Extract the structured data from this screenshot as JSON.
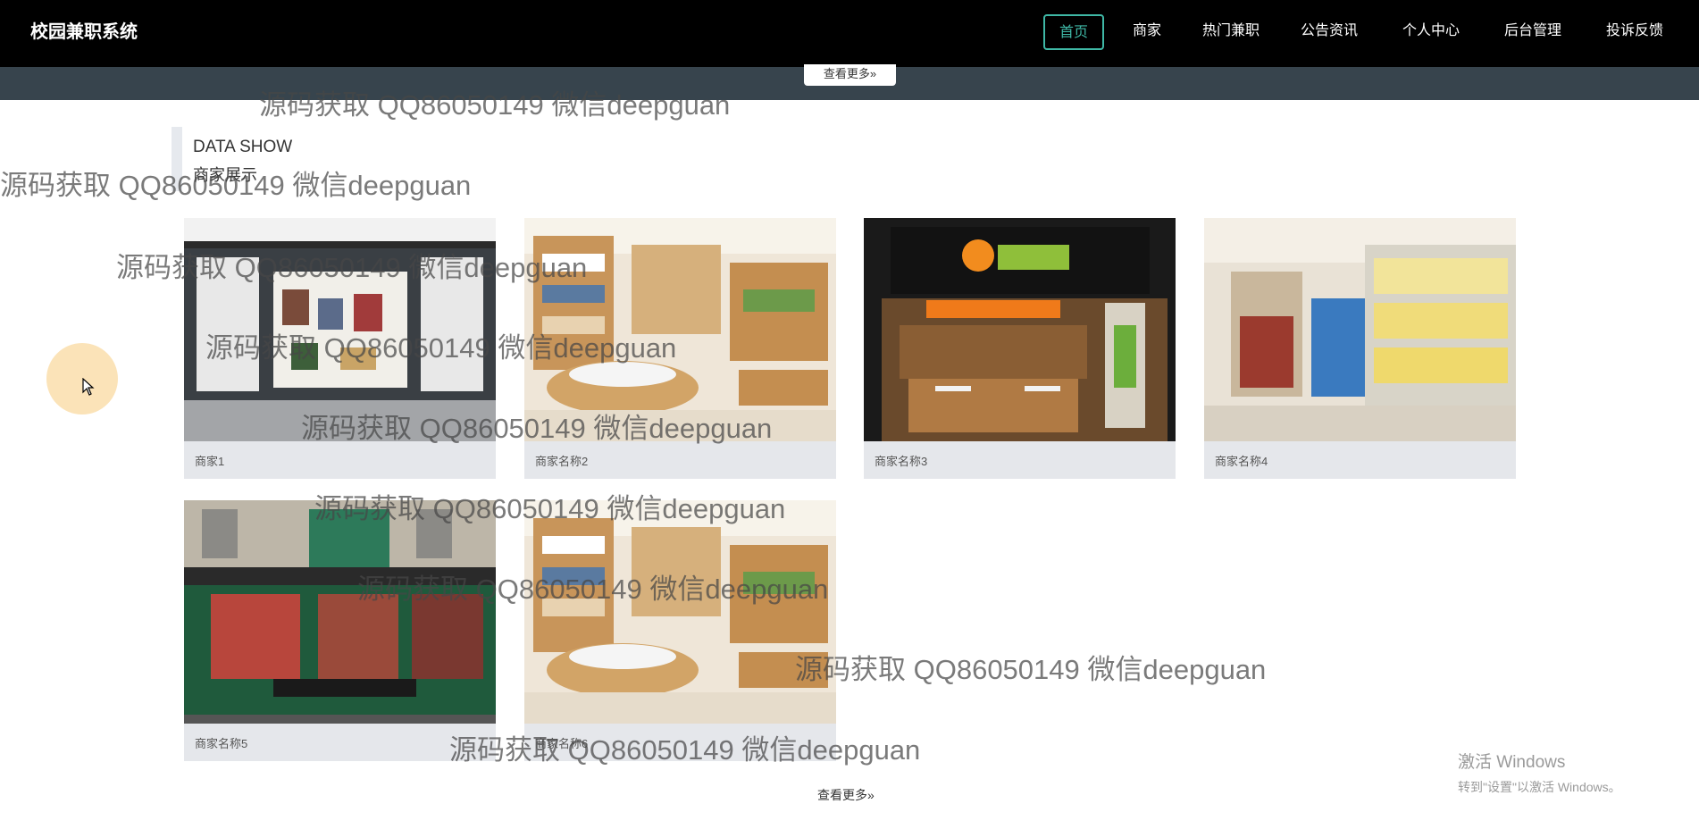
{
  "app": {
    "title": "校园兼职系统"
  },
  "nav": {
    "items": [
      {
        "label": "首页",
        "active": true
      },
      {
        "label": "商家"
      },
      {
        "label": "热门兼职"
      },
      {
        "label": "公告资讯"
      },
      {
        "label": "个人中心"
      },
      {
        "label": "后台管理"
      },
      {
        "label": "投诉反馈"
      }
    ]
  },
  "banner": {
    "more_label": "查看更多»"
  },
  "section": {
    "title_en": "DATA SHOW",
    "title_cn": "商家展示",
    "more_label": "查看更多»"
  },
  "cards": [
    {
      "name": "商家1",
      "image": "store-front-photo"
    },
    {
      "name": "商家名称2",
      "image": "shop-interior-photo"
    },
    {
      "name": "商家名称3",
      "image": "tea-shop-photo"
    },
    {
      "name": "商家名称4",
      "image": "supermarket-photo"
    },
    {
      "name": "商家名称5",
      "image": "dessert-shop-photo"
    },
    {
      "name": "商家名称6",
      "image": "shop-interior-photo"
    }
  ],
  "watermark": {
    "text": "源码获取 QQ86050149 微信deepguan"
  },
  "os_notice": {
    "title": "激活 Windows",
    "subtitle": "转到\"设置\"以激活 Windows。"
  },
  "colors": {
    "nav_bg": "#000000",
    "nav_active": "#3fb8a6",
    "strip_bg": "#37444d",
    "card_bg": "#e5e7eb"
  }
}
